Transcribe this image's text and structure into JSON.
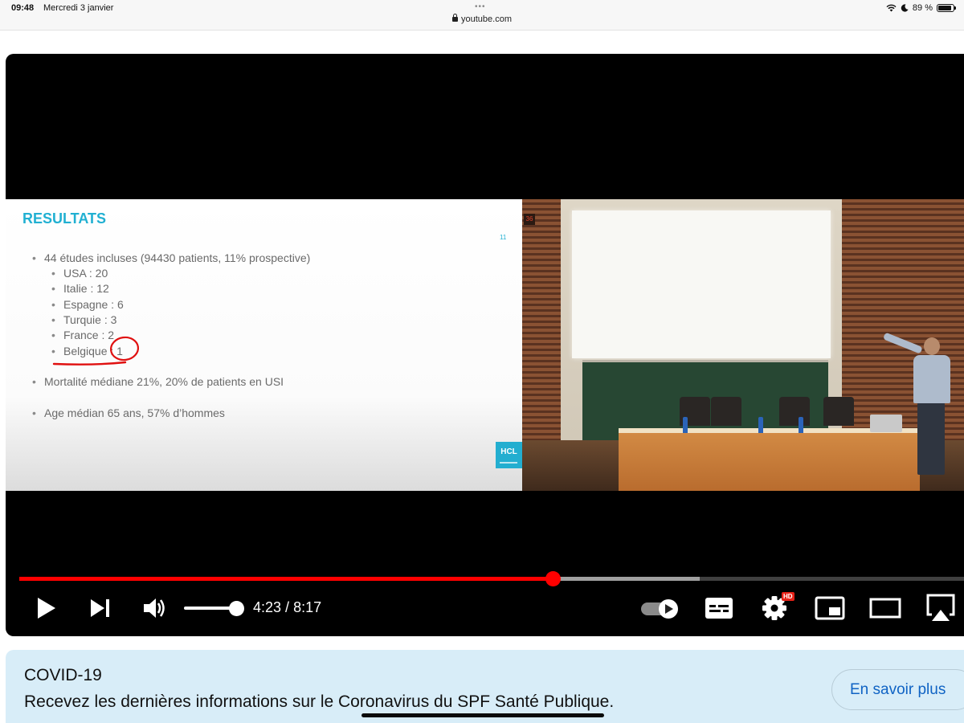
{
  "status_bar": {
    "time": "09:48",
    "date": "Mercredi 3 janvier",
    "url": "youtube.com",
    "battery_text": "89 %",
    "battery_level": 0.89,
    "icons": [
      "wifi-icon",
      "moon-icon",
      "battery-icon"
    ]
  },
  "slide": {
    "title": "RESULTATS",
    "page_number": "11",
    "bullets": [
      "44 études incluses (94430 patients, 11% prospective)",
      "Mortalité médiane 21%, 20% de patients en  USI",
      "Age médian 65 ans, 57% d’hommes"
    ],
    "sub_bullets": [
      "USA : 20",
      "Italie : 12",
      "Espagne : 6",
      "Turquie : 3",
      "France : 2",
      "Belgique : 1"
    ],
    "logo_text": "HCL",
    "annotation_color": "#e01010",
    "title_color": "#21b0d2"
  },
  "video": {
    "clock_text": "36",
    "progress_fraction": 0.565,
    "buffered_fraction": 0.72,
    "current_time": "4:23",
    "duration": "8:17",
    "time_display": "4:23 / 8:17",
    "volume_level": 1.0,
    "autoplay_on": true,
    "hd_badge": "HD",
    "accent_color": "#ff0000"
  },
  "info_panel": {
    "title": "COVID-19",
    "text": "Recevez les dernières informations sur le Coronavirus du SPF Santé Publique.",
    "button_label": "En savoir plus",
    "background_color": "#d8edf8",
    "button_color": "#0f63c4"
  }
}
